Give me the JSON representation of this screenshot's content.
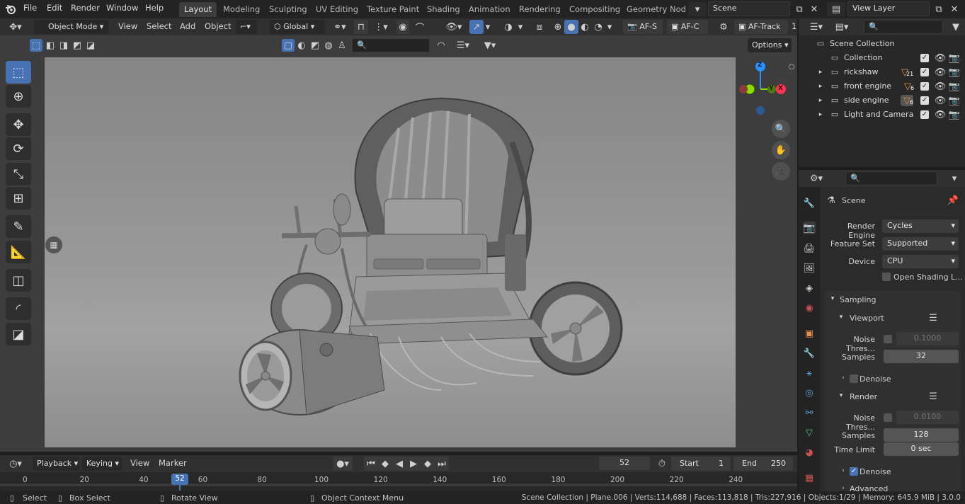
{
  "menu": {
    "items": [
      "File",
      "Edit",
      "Render",
      "Window",
      "Help"
    ],
    "tabs": [
      "Layout",
      "Modeling",
      "Sculpting",
      "UV Editing",
      "Texture Paint",
      "Shading",
      "Animation",
      "Rendering",
      "Compositing",
      "Geometry Nod"
    ],
    "scene": "Scene",
    "view_layer": "View Layer"
  },
  "viewport_header": {
    "mode": "Object Mode",
    "view": "View",
    "select": "Select",
    "add": "Add",
    "object": "Object",
    "orientation": "Global",
    "af_s": "AF-S",
    "af_c": "AF-C",
    "af_track": "AF-Track",
    "af_track_suffix": "1",
    "options": "Options"
  },
  "gizmo": {
    "z": "Z",
    "y": "Y",
    "x": "X"
  },
  "outliner": {
    "root": "Scene Collection",
    "rows": [
      {
        "label": "Collection",
        "badge": ""
      },
      {
        "label": "rickshaw",
        "badge": "21"
      },
      {
        "label": "front engine",
        "badge": "6"
      },
      {
        "label": "side engine",
        "badge": "6"
      },
      {
        "label": "Light and Camera",
        "badge": ""
      }
    ]
  },
  "properties": {
    "context": "Scene",
    "render_engine_label": "Render Engine",
    "render_engine": "Cycles",
    "feature_set_label": "Feature Set",
    "feature_set": "Supported",
    "device_label": "Device",
    "device": "CPU",
    "open_shading": "Open Shading L...",
    "sampling": "Sampling",
    "viewport": "Viewport",
    "noise_label": "Noise Thres...",
    "viewport_noise": "0.1000",
    "samples_label": "Samples",
    "viewport_samples": "32",
    "denoise": "Denoise",
    "render": "Render",
    "render_noise": "0.0100",
    "render_samples": "128",
    "time_limit_label": "Time Limit",
    "time_limit": "0 sec",
    "advanced": "Advanced"
  },
  "timeline": {
    "playback": "Playback",
    "keying": "Keying",
    "view": "View",
    "marker": "Marker",
    "current_frame": "52",
    "start_label": "Start",
    "start": "1",
    "end_label": "End",
    "end": "250",
    "ticks": [
      "0",
      "20",
      "40",
      "60",
      "80",
      "100",
      "120",
      "140",
      "160",
      "180",
      "200",
      "220",
      "240"
    ]
  },
  "status": {
    "select": "Select",
    "box_select": "Box Select",
    "rotate_view": "Rotate View",
    "context_menu": "Object Context Menu",
    "stats": "Scene Collection | Plane.006 | Verts:114,688 | Faces:113,818 | Tris:227,916 | Objects:1/29 | Memory: 645.9 MiB | 3.0.0"
  },
  "colors": {
    "accent": "#4772b3",
    "x_axis": "#ff3352",
    "y_axis": "#8bdc00",
    "z_axis": "#2890ff",
    "badge": "#e8914a"
  }
}
